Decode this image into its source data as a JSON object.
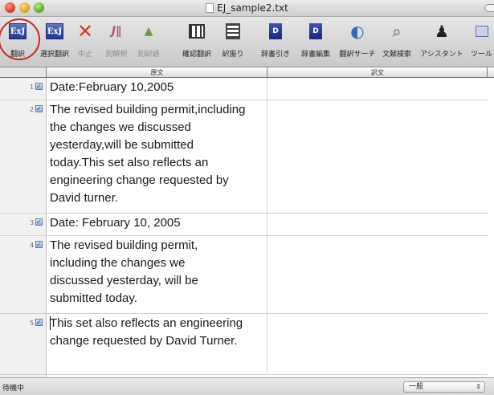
{
  "window": {
    "title": "EJ_sample2.txt"
  },
  "toolbar": {
    "translate": "翻訳",
    "selection_translate": "選択翻訳",
    "stop": "中止",
    "alt_explain": "別解釈",
    "alt_word": "別訳語",
    "confirm_translate": "確認翻訳",
    "translation_assign": "訳振り",
    "dict_lookup": "辞書引き",
    "dict_edit": "辞書編集",
    "translation_search": "翻訳サーチ",
    "literature_search": "文献検索",
    "assistant": "アシスタント",
    "tools": "ツール",
    "ej_label": "ExJ",
    "d_label": "D"
  },
  "columns": {
    "source": "原文",
    "translation": "訳文"
  },
  "rows": [
    {
      "num": "1",
      "check": "✓",
      "source": "Date:February 10,2005",
      "translation": ""
    },
    {
      "num": "2",
      "check": "✓",
      "source": "The revised building permit,including the changes we discussed yesterday,will be submitted today.This set also reflects an engineering change requested by David turner.",
      "translation": ""
    },
    {
      "num": "3",
      "check": "✓",
      "source": "Date: February 10, 2005",
      "translation": ""
    },
    {
      "num": "4",
      "check": "✓",
      "source": "The revised building permit, including the changes we discussed yesterday, will be submitted today.",
      "translation": ""
    },
    {
      "num": "5",
      "check": "✓",
      "source": "This set also reflects an engineering change requested by David Turner.",
      "translation": ""
    }
  ],
  "status": {
    "text": "待機中",
    "mode": "一般"
  },
  "colors": {
    "highlight_circle": "#c8281e",
    "close": "#e0402c",
    "minimize": "#e2a41c",
    "zoom": "#55b22a"
  }
}
